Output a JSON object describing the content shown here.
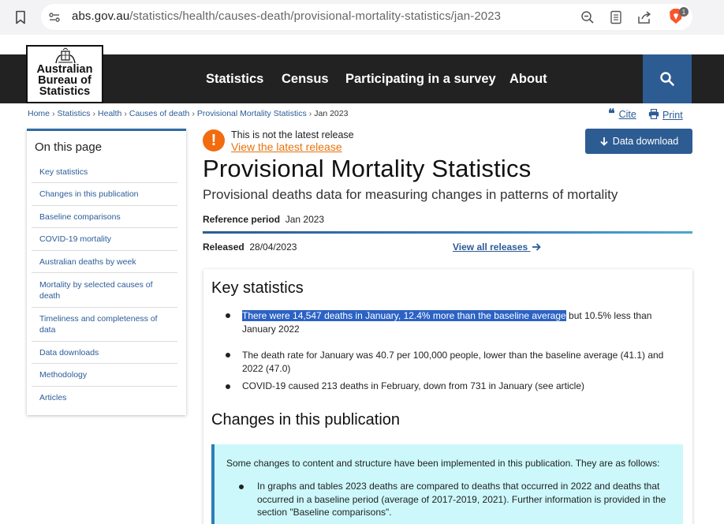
{
  "browser": {
    "url_domain": "abs.gov.au",
    "url_path": "/statistics/health/causes-death/provisional-mortality-statistics/jan-2023",
    "extension_badge": "1"
  },
  "header": {
    "logo_lines": [
      "Australian",
      "Bureau of",
      "Statistics"
    ],
    "nav": [
      "Statistics",
      "Census",
      "Participating in a survey",
      "About"
    ]
  },
  "breadcrumb": {
    "items": [
      "Home",
      "Statistics",
      "Health",
      "Causes of death",
      "Provisional Mortality Statistics"
    ],
    "current": "Jan 2023"
  },
  "actions": {
    "cite": "Cite",
    "print": "Print",
    "download": "Data download"
  },
  "sidebar": {
    "title": "On this page",
    "items": [
      "Key statistics",
      "Changes in this publication",
      "Baseline comparisons",
      "COVID-19 mortality",
      "Australian deaths by week",
      "Mortality by selected causes of death",
      "Timeliness and completeness of data",
      "Data downloads",
      "Methodology",
      "Articles"
    ]
  },
  "notice": {
    "text": "This is not the latest release",
    "link": "View the latest release"
  },
  "page": {
    "title": "Provisional Mortality Statistics",
    "subtitle": "Provisional deaths data for measuring changes in patterns of mortality",
    "ref_label": "Reference period",
    "ref_value": "Jan 2023",
    "released_label": "Released",
    "released_value": "28/04/2023",
    "all_releases": "View all releases"
  },
  "key_stats": {
    "heading": "Key statistics",
    "items": [
      {
        "highlighted": "There were 14,547 deaths in January, 12.4% more than the baseline average",
        "rest": " but 10.5% less than January 2022"
      },
      {
        "highlighted": "",
        "rest": "The death rate for January was 40.7 per 100,000 people, lower than the baseline average (41.1) and 2022 (47.0)"
      },
      {
        "highlighted": "",
        "rest": "COVID-19 caused 213 deaths in February, down from 731 in January (see article)"
      }
    ]
  },
  "changes": {
    "heading": "Changes in this publication",
    "intro": "Some changes to content and structure have been implemented in this publication. They are as follows:",
    "items": [
      "In graphs and tables 2023 deaths are compared to deaths that occurred in 2022 and deaths that occurred in a baseline period (average of 2017-2019, 2021). Further information is provided in the section \"Baseline comparisons\"."
    ]
  }
}
